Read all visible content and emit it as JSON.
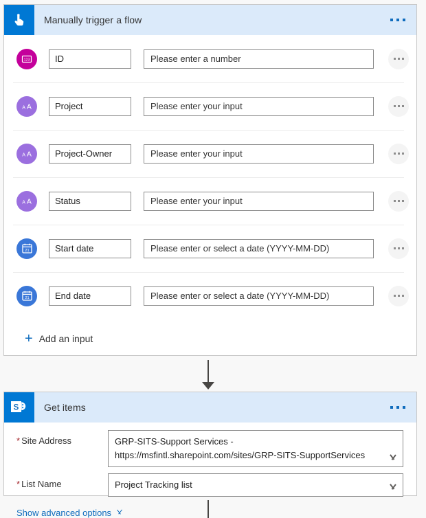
{
  "theme": {
    "page_bg": "#f8f8f8",
    "header_bg": "#dbeafa",
    "accent_blue": "#0078d4",
    "link_blue": "#0f6cbd",
    "required_red": "#a4262c",
    "number_icon_color": "#c4009b",
    "text_icon_color": "#9b6fdf",
    "date_icon_color": "#3a77d8",
    "connector_color": "#484644"
  },
  "trigger_card": {
    "title": "Manually trigger a flow",
    "icon": "manual-trigger-hand-icon",
    "more_menu": "card-overflow-menu",
    "inputs": [
      {
        "icon": "number-type-icon",
        "icon_glyph": "123",
        "type": "number",
        "name": "ID",
        "placeholder": "Please enter a number",
        "row_menu": "input-overflow-menu"
      },
      {
        "icon": "text-type-icon",
        "icon_glyph": "AA",
        "type": "text",
        "name": "Project",
        "placeholder": "Please enter your input",
        "row_menu": "input-overflow-menu"
      },
      {
        "icon": "text-type-icon",
        "icon_glyph": "AA",
        "type": "text",
        "name": "Project-Owner",
        "placeholder": "Please enter your input",
        "row_menu": "input-overflow-menu"
      },
      {
        "icon": "text-type-icon",
        "icon_glyph": "AA",
        "type": "text",
        "name": "Status",
        "placeholder": "Please enter your input",
        "row_menu": "input-overflow-menu"
      },
      {
        "icon": "date-type-icon",
        "icon_glyph": "21",
        "type": "date",
        "name": "Start date",
        "placeholder": "Please enter or select a date (YYYY-MM-DD)",
        "row_menu": "input-overflow-menu"
      },
      {
        "icon": "date-type-icon",
        "icon_glyph": "21",
        "type": "date",
        "name": "End date",
        "placeholder": "Please enter or select a date (YYYY-MM-DD)",
        "row_menu": "input-overflow-menu"
      }
    ],
    "add_input_label": "Add an input",
    "add_input_icon": "plus-icon"
  },
  "getitems_card": {
    "title": "Get items",
    "icon": "sharepoint-icon",
    "more_menu": "card-overflow-menu",
    "fields": [
      {
        "label": "Site Address",
        "required": true,
        "value": "GRP-SITS-Support Services - https://msfintl.sharepoint.com/sites/GRP-SITS-SupportServices",
        "control": "dropdown"
      },
      {
        "label": "List Name",
        "required": true,
        "value": "Project Tracking list",
        "control": "dropdown"
      }
    ],
    "advanced_link": "Show advanced options",
    "advanced_icon": "chevron-down-icon"
  }
}
